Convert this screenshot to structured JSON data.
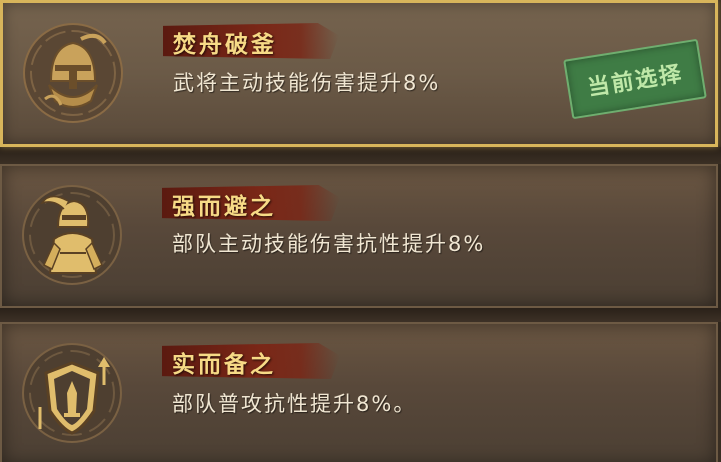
{
  "talents": [
    {
      "title": "焚舟破釜",
      "description": "武将主动技能伤害提升8%",
      "icon": "warrior-helmet-icon",
      "selected": true
    },
    {
      "title": "强而避之",
      "description": "部队主动技能伤害抗性提升8%",
      "icon": "armored-soldier-icon",
      "selected": false
    },
    {
      "title": "实而备之",
      "description": "部队普攻抗性提升8%。",
      "icon": "shield-sword-icon",
      "selected": false
    }
  ],
  "current_selection_label": "当前选择",
  "colors": {
    "selected_border": "#d8b55b",
    "title_text": "#f7da86",
    "banner": "#7a2717",
    "stamp_bg": "#3f7c45",
    "stamp_text": "#bfe8a8"
  }
}
